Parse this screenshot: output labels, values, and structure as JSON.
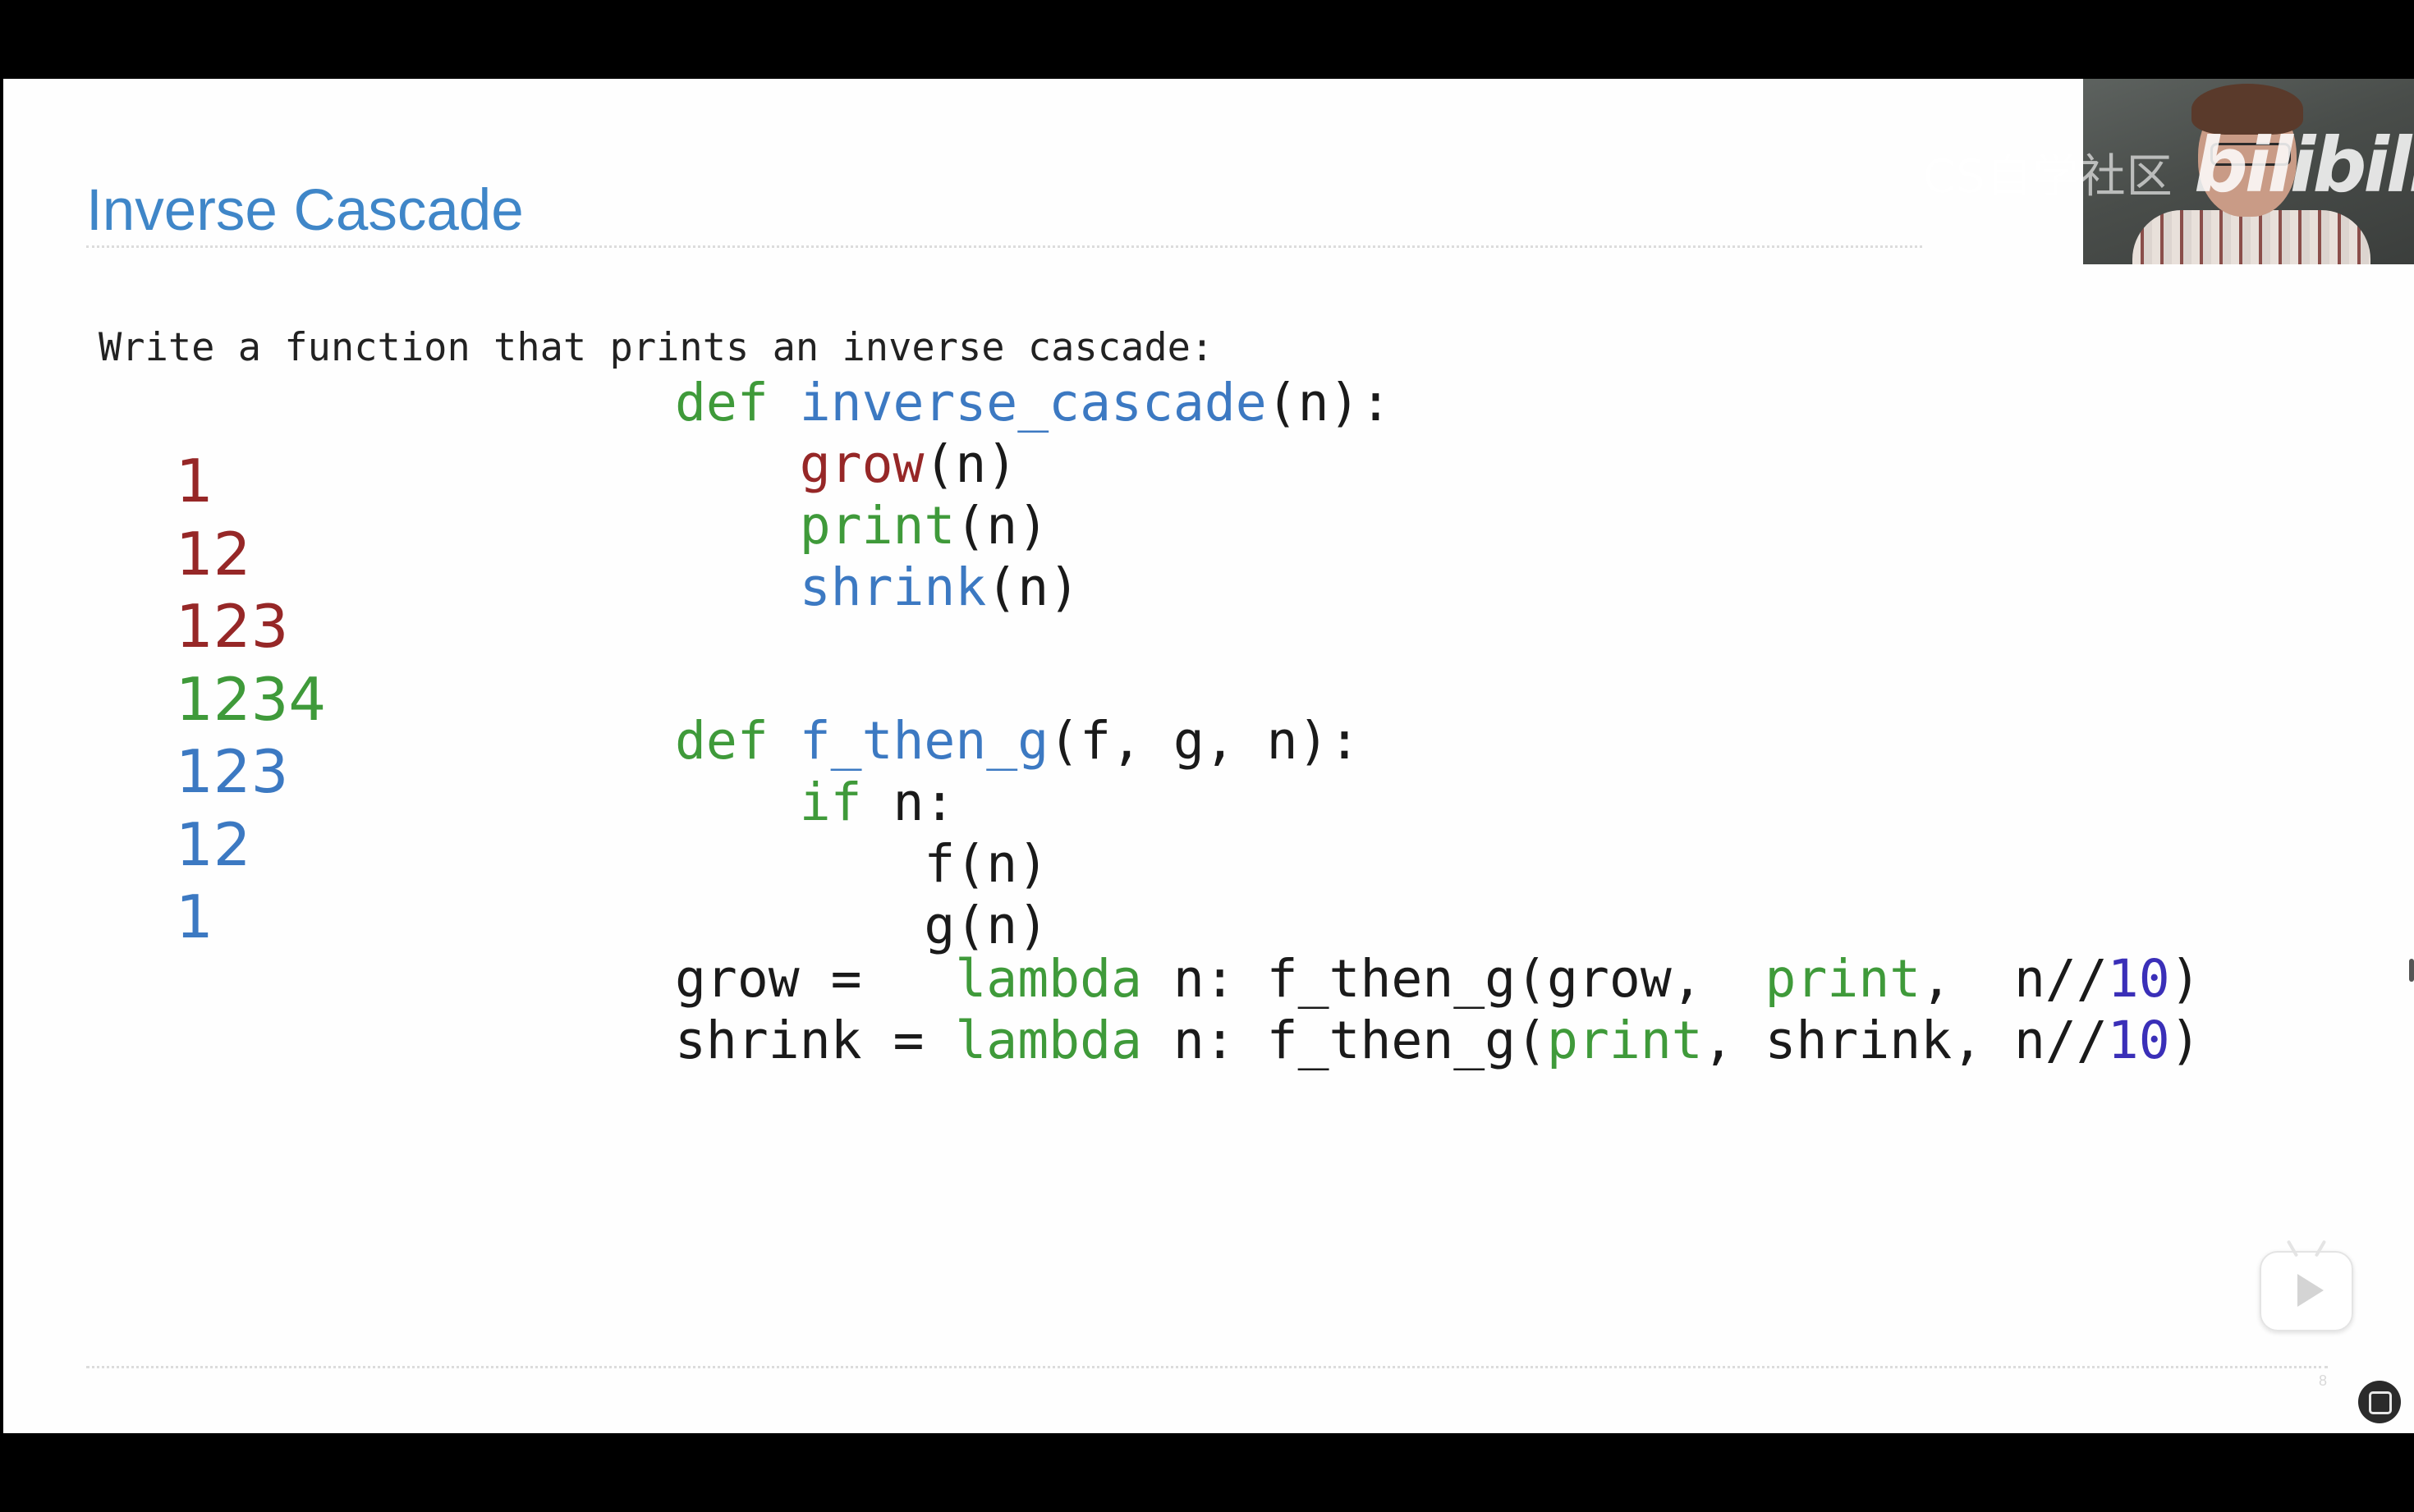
{
  "slide": {
    "title": "Inverse Cascade",
    "intro": "Write a function that prints an inverse cascade:",
    "page_number": "8"
  },
  "cascade_output": [
    {
      "text": "1",
      "color": "#962727"
    },
    {
      "text": "12",
      "color": "#962727"
    },
    {
      "text": "123",
      "color": "#962727"
    },
    {
      "text": "1234",
      "color": "#3f9a3a"
    },
    {
      "text": "123",
      "color": "#3c79c2"
    },
    {
      "text": "12",
      "color": "#3c79c2"
    },
    {
      "text": "1",
      "color": "#3c79c2"
    }
  ],
  "code": {
    "block1": [
      [
        {
          "t": "def ",
          "c": "kw"
        },
        {
          "t": "inverse_cascade",
          "c": "fn"
        },
        {
          "t": "(n):",
          "c": ""
        }
      ],
      [
        {
          "t": "    ",
          "c": ""
        },
        {
          "t": "grow",
          "c": "red"
        },
        {
          "t": "(n)",
          "c": ""
        }
      ],
      [
        {
          "t": "    ",
          "c": ""
        },
        {
          "t": "print",
          "c": "kw"
        },
        {
          "t": "(n)",
          "c": ""
        }
      ],
      [
        {
          "t": "    ",
          "c": ""
        },
        {
          "t": "shrink",
          "c": "fn"
        },
        {
          "t": "(n)",
          "c": ""
        }
      ]
    ],
    "block2": [
      [
        {
          "t": "def ",
          "c": "kw"
        },
        {
          "t": "f_then_g",
          "c": "fn"
        },
        {
          "t": "(f, g, n):",
          "c": ""
        }
      ],
      [
        {
          "t": "    ",
          "c": ""
        },
        {
          "t": "if",
          "c": "kw"
        },
        {
          "t": " n:",
          "c": ""
        }
      ],
      [
        {
          "t": "        f(n)",
          "c": ""
        }
      ],
      [
        {
          "t": "        g(n)",
          "c": ""
        }
      ]
    ],
    "block3": [
      [
        {
          "t": "grow =   ",
          "c": ""
        },
        {
          "t": "lambda",
          "c": "kw"
        },
        {
          "t": " n: f_then_g(grow,  ",
          "c": ""
        },
        {
          "t": "print",
          "c": "kw"
        },
        {
          "t": ",  n//",
          "c": ""
        },
        {
          "t": "10",
          "c": "num"
        },
        {
          "t": ")",
          "c": ""
        }
      ],
      [
        {
          "t": "shrink = ",
          "c": ""
        },
        {
          "t": "lambda",
          "c": "kw"
        },
        {
          "t": " n: f_then_g(",
          "c": ""
        },
        {
          "t": "print",
          "c": "kw"
        },
        {
          "t": ", shrink, n//",
          "c": ""
        },
        {
          "t": "10",
          "c": "num"
        },
        {
          "t": ")",
          "c": ""
        }
      ]
    ]
  },
  "overlay": {
    "watermark_text": "CS自学社区",
    "logo_text": "bilibili",
    "play_icon": "play-icon",
    "corner_icon": "subtitle-icon"
  },
  "colors": {
    "title": "#3f86c8",
    "keyword": "#3f9a3a",
    "function": "#3c79c2",
    "grow_call": "#962727",
    "number": "#3a2fb8"
  }
}
